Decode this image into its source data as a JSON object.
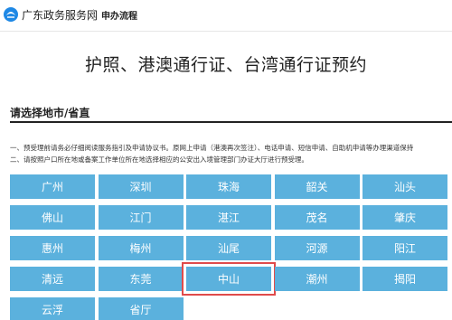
{
  "header": {
    "site_name": "广东政务服务网",
    "breadcrumb": "申办流程"
  },
  "page_title": "护照、港澳通行证、台湾通行证预约",
  "section": {
    "title": "请选择地市/省直",
    "notes": [
      "一、预受理前请务必仔细阅读服务指引及申请协议书。原网上申请（港澳再次签注）、电话申请、短信申请、自助机申请等办理渠道保持",
      "二、请按照户口所在地或备案工作单位所在地选择相应的公安出入境管理部门办证大厅进行预受理。"
    ]
  },
  "cities": [
    {
      "name": "广州",
      "selected": false
    },
    {
      "name": "深圳",
      "selected": false
    },
    {
      "name": "珠海",
      "selected": false
    },
    {
      "name": "韶关",
      "selected": false
    },
    {
      "name": "汕头",
      "selected": false
    },
    {
      "name": "佛山",
      "selected": false
    },
    {
      "name": "江门",
      "selected": false
    },
    {
      "name": "湛江",
      "selected": false
    },
    {
      "name": "茂名",
      "selected": false
    },
    {
      "name": "肇庆",
      "selected": false
    },
    {
      "name": "惠州",
      "selected": false
    },
    {
      "name": "梅州",
      "selected": false
    },
    {
      "name": "汕尾",
      "selected": false
    },
    {
      "name": "河源",
      "selected": false
    },
    {
      "name": "阳江",
      "selected": false
    },
    {
      "name": "清远",
      "selected": false
    },
    {
      "name": "东莞",
      "selected": false
    },
    {
      "name": "中山",
      "selected": true
    },
    {
      "name": "潮州",
      "selected": false
    },
    {
      "name": "揭阳",
      "selected": false
    },
    {
      "name": "云浮",
      "selected": false
    },
    {
      "name": "省厅",
      "selected": false
    }
  ],
  "colors": {
    "tile": "#5bb1dd",
    "selected_outline": "#e04b4b"
  }
}
